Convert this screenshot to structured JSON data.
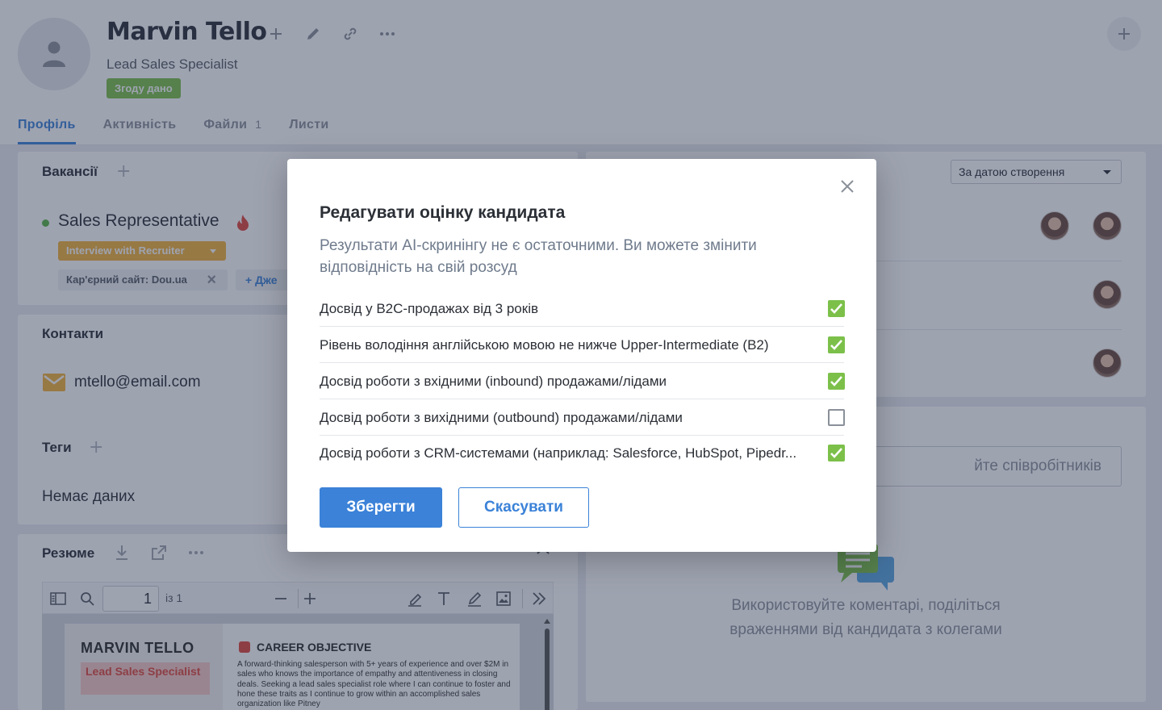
{
  "candidate": {
    "name": "Marvin Tello",
    "title": "Lead Sales Specialist",
    "consent_badge": "Згоду дано"
  },
  "tabs": [
    {
      "label": "Профіль",
      "active": true
    },
    {
      "label": "Активність"
    },
    {
      "label": "Файли",
      "count": "1"
    },
    {
      "label": "Листи"
    }
  ],
  "vacancies": {
    "title": "Вакансії",
    "name": "Sales Representative",
    "stage": "Interview with Recruiter",
    "source": "Кар'єрний сайт: Dou.ua",
    "add_tag_label": "Дже"
  },
  "contacts": {
    "title": "Контакти",
    "email": "mtello@email.com"
  },
  "tags": {
    "title": "Теги",
    "empty_text": "Немає даних"
  },
  "resume": {
    "title": "Резюме",
    "page_current": "1",
    "page_of": "із 1",
    "pdf_name": "MARVIN TELLO",
    "pdf_role": "Lead Sales Specialist",
    "pdf_section_title": "CAREER OBJECTIVE",
    "pdf_section_text": "A forward-thinking salesperson with 5+ years of experience and over $2M in sales who knows the importance of empathy and attentiveness in closing deals. Seeking a lead sales specialist role where I can continue to foster and hone these traits as I continue to grow within an accomplished sales organization like Pitney"
  },
  "right": {
    "sort_label": "За датою створення",
    "employee_search_placeholder": "йте співробітників",
    "comments_hint": "Використовуйте коментарі, поділіться враженнями від кандидата з колегами"
  },
  "modal": {
    "title": "Редагувати оцінку кандидата",
    "description": "Результати AI-скринінгу не є остаточними. Ви можете змінити відповідність на свій розсуд",
    "criteria": [
      {
        "label": "Досвід у B2C-продажах від 3 років",
        "checked": true
      },
      {
        "label": "Рівень володіння англійською мовою не нижче Upper-Intermediate (B2)",
        "checked": true
      },
      {
        "label": "Досвід роботи з вхідними (inbound) продажами/лідами",
        "checked": true
      },
      {
        "label": "Досвід роботи з вихідними (outbound) продажами/лідами",
        "checked": false
      },
      {
        "label": "Досвід роботи з CRM-системами (наприклад: Salesforce, HubSpot, Pipedr...",
        "checked": true
      }
    ],
    "save_label": "Зберегти",
    "cancel_label": "Скасувати"
  },
  "colors": {
    "accent": "#3b82d8",
    "success": "#7cc04a",
    "stage": "#f3b33b"
  }
}
